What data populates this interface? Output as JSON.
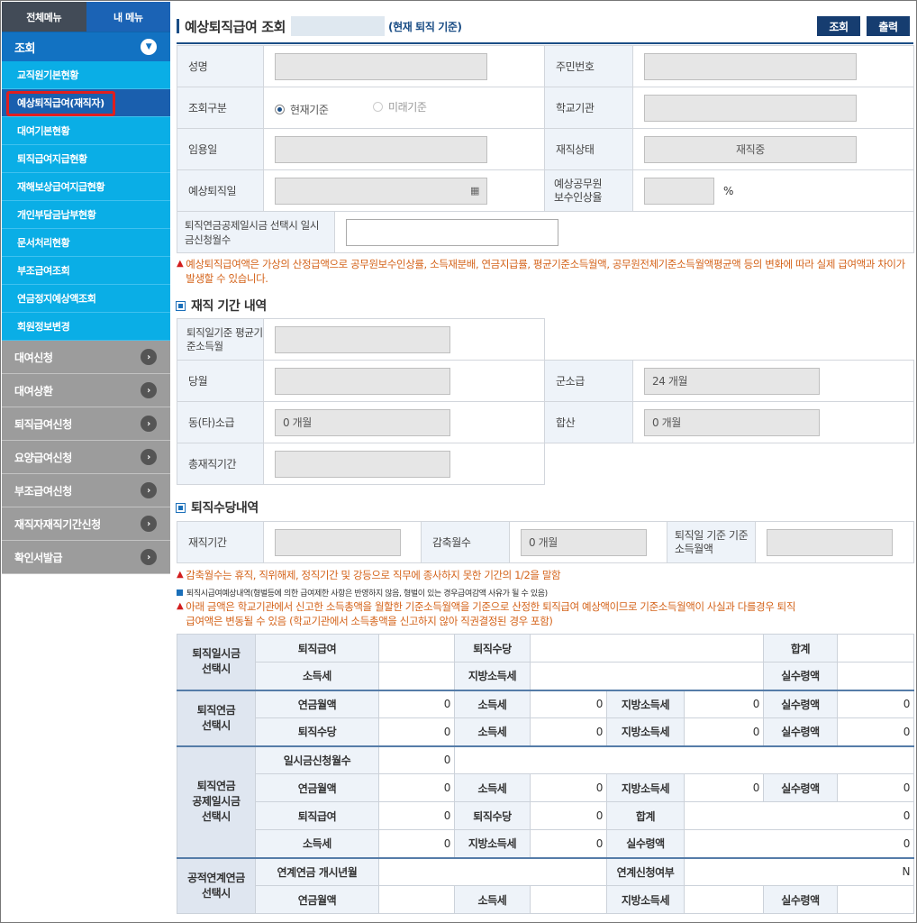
{
  "sidebar": {
    "tab_all": "전체메뉴",
    "tab_my": "내 메뉴",
    "group_open": "조회",
    "sub": [
      "교직원기본현황",
      "예상퇴직급여(재직자)",
      "대여기본현황",
      "퇴직급여지급현황",
      "재해보상급여지급현황",
      "개인부담금납부현황",
      "문서처리현황",
      "부조급여조회",
      "연금정지예상액조회",
      "회원정보변경"
    ],
    "groups": [
      "대여신청",
      "대여상환",
      "퇴직급여신청",
      "요양급여신청",
      "부조급여신청",
      "재직자재직기간신청",
      "확인서발급"
    ]
  },
  "header": {
    "title": "예상퇴직급여 조회",
    "subtitle": "(현재 퇴직 기준)",
    "btn_query": "조회",
    "btn_print": "출력"
  },
  "form": {
    "name_label": "성명",
    "rrn_label": "주민번호",
    "type_label": "조회구분",
    "radio_current": "현재기준",
    "radio_future": "미래기준",
    "school_label": "학교기관",
    "hire_label": "임용일",
    "status_label": "재직상태",
    "status_value": "재직중",
    "retire_label": "예상퇴직일",
    "raise_label": "예상공무원\n보수인상율",
    "raise_unit": "%",
    "lump_label": "퇴직연금공제일시금 선택시 일시금신청월수"
  },
  "warn1": "예상퇴직급여액은 가상의 산정급액으로 공무원보수인상률, 소득재분배, 연금지급률, 평균기준소득월액, 공무원전체기준소득월액평균액  등의 변화에 따라 실제 급여액과 차이가 발생할 수 있습니다.",
  "sec1": "재직 기간 내역",
  "period": {
    "avg_label": "퇴직일기준 평균기준소득월",
    "month_label": "당월",
    "mil_label": "군소급",
    "mil_value": "24 개월",
    "other_label": "동(타)소급",
    "other_value": "0 개월",
    "sum_label": "합산",
    "sum_value": "0 개월",
    "total_label": "총재직기간"
  },
  "sec2": "퇴직수당내역",
  "allow": {
    "service_label": "재직기간",
    "reduce_label": "감축월수",
    "reduce_value": "0 개월",
    "base_label": "퇴직일 기준 기준소득월액"
  },
  "warn2": "감축월수는 휴직, 직위해제, 정직기간 및 강등으로 직무에 종사하지 못한 기간의 1/2을 말함",
  "note": "퇴직시급여예상내역(형벌등에 의한 급여제한 사항은 반영하지 않음, 형벌이 있는 경우급여감액 사유가 될 수 있음)",
  "warn3": "아래 금액은 학교기관에서 신고한 소득총액을 월할한 기준소득월액을 기준으로 산정한 퇴직급여 예상액이므로 기준소득월액이 사실과 다를경우 퇴직급여액은 변동될 수 있음 (학교기관에서 소득총액을 신고하지 않아 직권결정된 경우 포함)",
  "grid": {
    "g1": "퇴직일시금\n선택시",
    "g2": "퇴직연금\n선택시",
    "g3": "퇴직연금\n공제일시금\n선택시",
    "g4": "공적연계연금\n선택시",
    "retire_pay": "퇴직급여",
    "retire_allow": "퇴직수당",
    "total": "합계",
    "income_tax": "소득세",
    "local_tax": "지방소득세",
    "net": "실수령액",
    "pension_month": "연금월액",
    "lump_months": "일시금신청월수",
    "link_start": "연계연금 개시년월",
    "link_apply": "연계신청여부",
    "zero": "0",
    "n_value": "N"
  }
}
